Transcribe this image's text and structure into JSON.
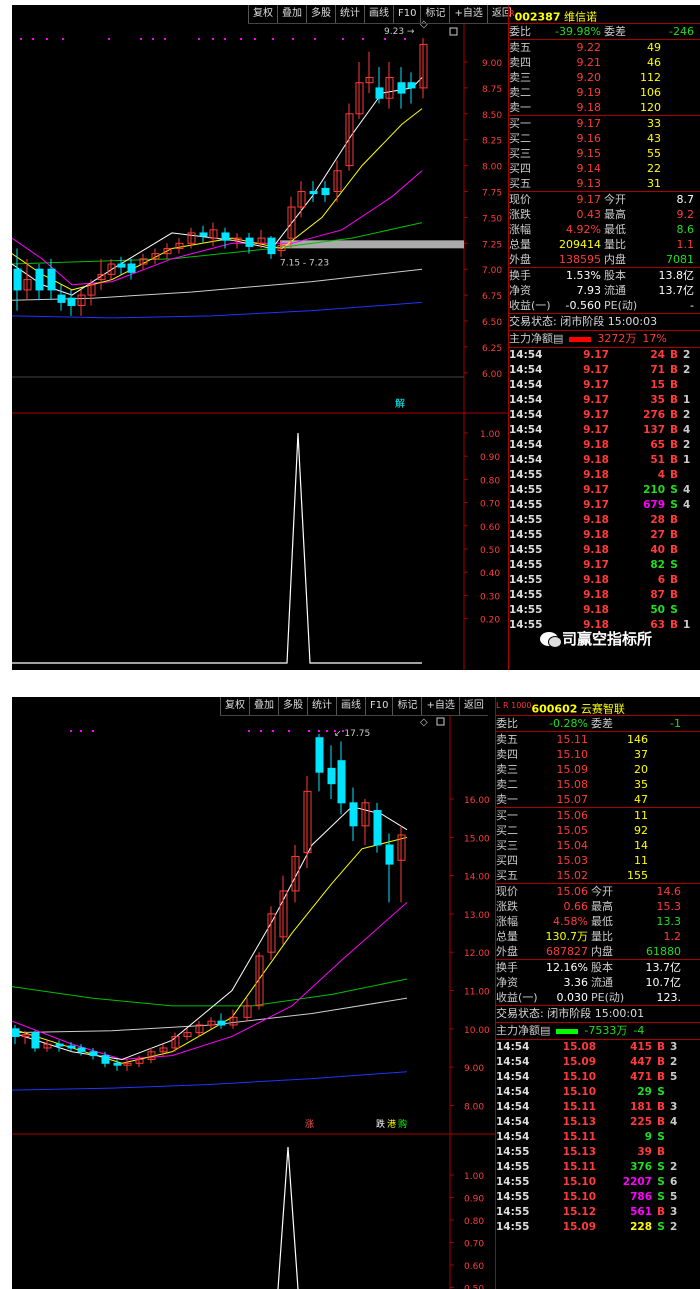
{
  "toolbar": {
    "items": [
      "复权",
      "叠加",
      "多股",
      "统计",
      "画线",
      "F10",
      "标记",
      "+自选",
      "返回"
    ]
  },
  "panels": [
    {
      "stock": {
        "mark": "R",
        "code": "002387",
        "name": "维信诺"
      },
      "price_axis": [
        "9.00",
        "8.75",
        "8.50",
        "8.25",
        "8.00",
        "7.75",
        "7.50",
        "7.25",
        "7.00",
        "6.75",
        "6.50",
        "6.25",
        "6.00"
      ],
      "price_min": 6.0,
      "price_max": 9.0,
      "high_label": "9.23",
      "range_label": "7.15 - 7.23",
      "signal_labels": [
        "解"
      ],
      "ind_axis": [
        "1.00",
        "0.90",
        "0.80",
        "0.70",
        "0.60",
        "0.50",
        "0.40",
        "0.30",
        "0.20"
      ],
      "quote": {
        "weibi": {
          "l": "委比",
          "v": "-39.98%",
          "l2": "委差",
          "v2": "-246"
        },
        "asks": [
          {
            "l": "卖五",
            "p": "9.22",
            "q": "49"
          },
          {
            "l": "卖四",
            "p": "9.21",
            "q": "46"
          },
          {
            "l": "卖三",
            "p": "9.20",
            "q": "112"
          },
          {
            "l": "卖二",
            "p": "9.19",
            "q": "106"
          },
          {
            "l": "卖一",
            "p": "9.18",
            "q": "120"
          }
        ],
        "bids": [
          {
            "l": "买一",
            "p": "9.17",
            "q": "33"
          },
          {
            "l": "买二",
            "p": "9.16",
            "q": "43"
          },
          {
            "l": "买三",
            "p": "9.15",
            "q": "55"
          },
          {
            "l": "买四",
            "p": "9.14",
            "q": "22"
          },
          {
            "l": "买五",
            "p": "9.13",
            "q": "31"
          }
        ],
        "stats": [
          {
            "l": "现价",
            "v": "9.17",
            "c": "red",
            "l2": "今开",
            "v2": "8.7",
            "c2": "wht"
          },
          {
            "l": "涨跌",
            "v": "0.43",
            "c": "red",
            "l2": "最高",
            "v2": "9.2",
            "c2": "red"
          },
          {
            "l": "涨幅",
            "v": "4.92%",
            "c": "red",
            "l2": "最低",
            "v2": "8.6",
            "c2": "grn"
          },
          {
            "l": "总量",
            "v": "209414",
            "c": "yel",
            "l2": "量比",
            "v2": "1.1",
            "c2": "red"
          },
          {
            "l": "外盘",
            "v": "138595",
            "c": "red",
            "l2": "内盘",
            "v2": "7081",
            "c2": "grn"
          }
        ],
        "stats2": [
          {
            "l": "换手",
            "v": "1.53%",
            "c": "wht",
            "l2": "股本",
            "v2": "13.8亿",
            "c2": "wht"
          },
          {
            "l": "净资",
            "v": "7.93",
            "c": "wht",
            "l2": "流通",
            "v2": "13.7亿",
            "c2": "wht"
          },
          {
            "l": "收益(一)",
            "v": "-0.560",
            "c": "wht",
            "l2": "PE(动)",
            "v2": "-",
            "c2": "wht"
          }
        ],
        "status": "交易状态: 闭市阶段 15:00:03",
        "flow": {
          "l": "主力净额",
          "v": "3272万",
          "v2": "17%",
          "c": "red"
        }
      },
      "ticks": [
        [
          "14:54",
          "9.17",
          "24",
          "B",
          "red",
          "red",
          "2"
        ],
        [
          "14:54",
          "9.17",
          "71",
          "B",
          "red",
          "red",
          "2"
        ],
        [
          "14:54",
          "9.17",
          "15",
          "B",
          "red",
          "red",
          ""
        ],
        [
          "14:54",
          "9.17",
          "35",
          "B",
          "red",
          "red",
          "1"
        ],
        [
          "14:54",
          "9.17",
          "276",
          "B",
          "red",
          "red",
          "2"
        ],
        [
          "14:54",
          "9.17",
          "137",
          "B",
          "red",
          "red",
          "4"
        ],
        [
          "14:54",
          "9.18",
          "65",
          "B",
          "red",
          "red",
          "2"
        ],
        [
          "14:54",
          "9.18",
          "51",
          "B",
          "red",
          "red",
          "1"
        ],
        [
          "14:55",
          "9.18",
          "4",
          "B",
          "red",
          "red",
          ""
        ],
        [
          "14:55",
          "9.17",
          "210",
          "S",
          "red",
          "grn",
          "4"
        ],
        [
          "14:55",
          "9.17",
          "679",
          "S",
          "red",
          "mag",
          "4"
        ],
        [
          "14:55",
          "9.18",
          "28",
          "B",
          "red",
          "red",
          ""
        ],
        [
          "14:55",
          "9.18",
          "27",
          "B",
          "red",
          "red",
          ""
        ],
        [
          "14:55",
          "9.18",
          "40",
          "B",
          "red",
          "red",
          ""
        ],
        [
          "14:55",
          "9.17",
          "82",
          "S",
          "red",
          "grn",
          ""
        ],
        [
          "14:55",
          "9.18",
          "6",
          "B",
          "red",
          "red",
          ""
        ],
        [
          "14:55",
          "9.18",
          "87",
          "B",
          "red",
          "red",
          ""
        ],
        [
          "14:55",
          "9.18",
          "50",
          "S",
          "red",
          "grn",
          ""
        ],
        [
          "14:55",
          "9.18",
          "63",
          "B",
          "red",
          "red",
          "1"
        ]
      ]
    },
    {
      "stock": {
        "mark": "L R 1000",
        "code": "600602",
        "name": "云赛智联"
      },
      "price_axis": [
        "16.00",
        "15.00",
        "14.00",
        "13.00",
        "12.00",
        "11.00",
        "10.00",
        "9.00",
        "8.00"
      ],
      "price_min": 8.0,
      "price_max": 16.0,
      "high_label": "17.75",
      "range_label": "",
      "signal_labels": [
        "涨",
        "跌",
        "港",
        "购"
      ],
      "ind_axis": [
        "1.00",
        "0.90",
        "0.80",
        "0.70",
        "0.60",
        "0.50"
      ],
      "quote": {
        "weibi": {
          "l": "委比",
          "v": "-0.28%",
          "l2": "委差",
          "v2": "-1"
        },
        "asks": [
          {
            "l": "卖五",
            "p": "15.11",
            "q": "146"
          },
          {
            "l": "卖四",
            "p": "15.10",
            "q": "37"
          },
          {
            "l": "卖三",
            "p": "15.09",
            "q": "20"
          },
          {
            "l": "卖二",
            "p": "15.08",
            "q": "35"
          },
          {
            "l": "卖一",
            "p": "15.07",
            "q": "47"
          }
        ],
        "bids": [
          {
            "l": "买一",
            "p": "15.06",
            "q": "11"
          },
          {
            "l": "买二",
            "p": "15.05",
            "q": "92"
          },
          {
            "l": "买三",
            "p": "15.04",
            "q": "14"
          },
          {
            "l": "买四",
            "p": "15.03",
            "q": "11"
          },
          {
            "l": "买五",
            "p": "15.02",
            "q": "155"
          }
        ],
        "stats": [
          {
            "l": "现价",
            "v": "15.06",
            "c": "red",
            "l2": "今开",
            "v2": "14.6",
            "c2": "red"
          },
          {
            "l": "涨跌",
            "v": "0.66",
            "c": "red",
            "l2": "最高",
            "v2": "15.3",
            "c2": "red"
          },
          {
            "l": "涨幅",
            "v": "4.58%",
            "c": "red",
            "l2": "最低",
            "v2": "13.3",
            "c2": "grn"
          },
          {
            "l": "总量",
            "v": "130.7万",
            "c": "yel",
            "l2": "量比",
            "v2": "1.2",
            "c2": "red"
          },
          {
            "l": "外盘",
            "v": "687827",
            "c": "red",
            "l2": "内盘",
            "v2": "61880",
            "c2": "grn"
          }
        ],
        "stats2": [
          {
            "l": "换手",
            "v": "12.16%",
            "c": "wht",
            "l2": "股本",
            "v2": "13.7亿",
            "c2": "wht"
          },
          {
            "l": "净资",
            "v": "3.36",
            "c": "wht",
            "l2": "流通",
            "v2": "10.7亿",
            "c2": "wht"
          },
          {
            "l": "收益(一)",
            "v": "0.030",
            "c": "wht",
            "l2": "PE(动)",
            "v2": "123.",
            "c2": "wht"
          }
        ],
        "status": "交易状态: 闭市阶段 15:00:01",
        "flow": {
          "l": "主力净额",
          "v": "-7533万",
          "v2": "-4",
          "c": "grn"
        }
      },
      "ticks": [
        [
          "14:54",
          "15.08",
          "415",
          "B",
          "red",
          "red",
          "3"
        ],
        [
          "14:54",
          "15.09",
          "447",
          "B",
          "red",
          "red",
          "2"
        ],
        [
          "14:54",
          "15.10",
          "471",
          "B",
          "red",
          "red",
          "5"
        ],
        [
          "14:54",
          "15.10",
          "29",
          "S",
          "red",
          "grn",
          ""
        ],
        [
          "14:54",
          "15.11",
          "181",
          "B",
          "red",
          "red",
          "3"
        ],
        [
          "14:54",
          "15.13",
          "225",
          "B",
          "red",
          "red",
          "4"
        ],
        [
          "14:54",
          "15.11",
          "9",
          "S",
          "red",
          "grn",
          ""
        ],
        [
          "14:55",
          "15.13",
          "39",
          "B",
          "red",
          "red",
          ""
        ],
        [
          "14:55",
          "15.11",
          "376",
          "S",
          "red",
          "grn",
          "2"
        ],
        [
          "14:55",
          "15.10",
          "2207",
          "S",
          "red",
          "mag",
          "6"
        ],
        [
          "14:55",
          "15.10",
          "786",
          "S",
          "red",
          "mag",
          "5"
        ],
        [
          "14:55",
          "15.12",
          "561",
          "B",
          "red",
          "mag",
          "3"
        ],
        [
          "14:55",
          "15.09",
          "228",
          "S",
          "red",
          "yel",
          "2"
        ]
      ]
    }
  ],
  "watermark": "司赢空指标所",
  "colors": {
    "up": "#ff3b3b",
    "down": "#00e5ff",
    "ma5": "#ffffff",
    "ma10": "#ffff00",
    "ma20": "#ff00ff",
    "ma60": "#00c000",
    "ma120": "#cccccc",
    "ma250": "#2233ff"
  }
}
